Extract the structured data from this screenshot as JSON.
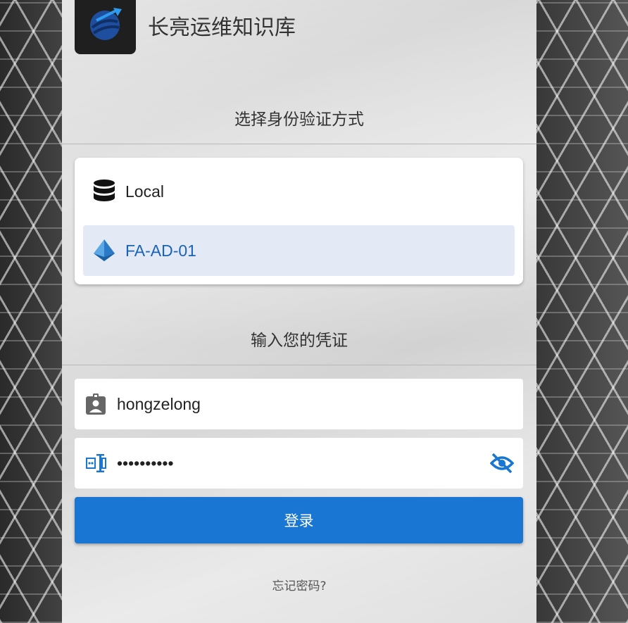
{
  "app": {
    "title": "长亮运维知识库",
    "logo_icon": "globe-arrow-logo"
  },
  "auth_section": {
    "title": "选择身份验证方式",
    "options": [
      {
        "label": "Local",
        "icon": "database-icon",
        "selected": false
      },
      {
        "label": "FA-AD-01",
        "icon": "azure-ad-icon",
        "selected": true
      }
    ]
  },
  "credentials_section": {
    "title": "输入您的凭证",
    "username": {
      "value": "hongzelong",
      "icon": "badge-account-icon"
    },
    "password": {
      "value": "••••••••••",
      "icon": "form-textbox-password-icon",
      "toggle_icon": "eye-off-icon"
    }
  },
  "login_button": {
    "label": "登录"
  },
  "forgot_link": {
    "label": "忘记密码?"
  },
  "colors": {
    "accent": "#1976d2",
    "selected_bg": "#e3eaf5",
    "selected_text": "#1b63b8"
  }
}
